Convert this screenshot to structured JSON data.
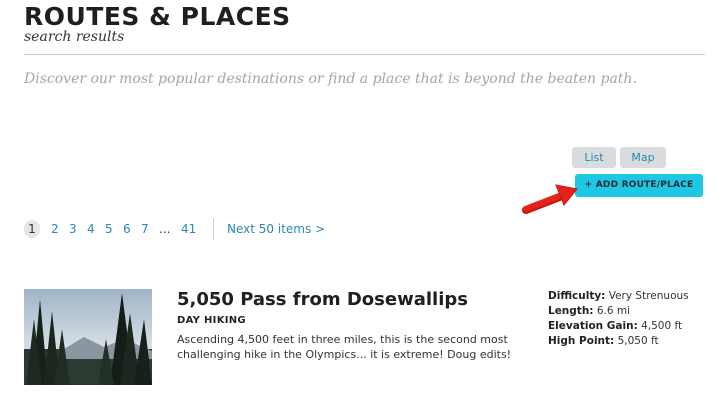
{
  "header": {
    "title": "ROUTES & PLACES",
    "subtitle": "search results"
  },
  "intro": "Discover our most popular destinations or find a place that is beyond the beaten path.",
  "view_toggle": {
    "list_label": "List",
    "map_label": "Map"
  },
  "add_button_label": "+ ADD ROUTE/PLACE",
  "pagination": {
    "current": "1",
    "pages": [
      "2",
      "3",
      "4",
      "5",
      "6",
      "7"
    ],
    "ellipsis": "...",
    "last": "41",
    "next_label": "Next 50 items >"
  },
  "results": [
    {
      "title": "5,050 Pass from Dosewallips",
      "category": "DAY HIKING",
      "description": "Ascending 4,500 feet in three miles, this is the second most challenging hike in the Olympics... it is extreme! Doug edits!",
      "specs": [
        {
          "label": "Difficulty:",
          "value": "Very Strenuous"
        },
        {
          "label": "Length:",
          "value": "6.6 mi"
        },
        {
          "label": "Elevation Gain:",
          "value": "4,500 ft"
        },
        {
          "label": "High Point:",
          "value": "5,050 ft"
        }
      ]
    }
  ],
  "colors": {
    "link": "#2a88b0",
    "accent_button": "#1ec8e4",
    "annotation_arrow": "#e8201a",
    "muted_text": "#a4a4a4"
  },
  "icons": {
    "annotation": "red-arrow-icon"
  }
}
